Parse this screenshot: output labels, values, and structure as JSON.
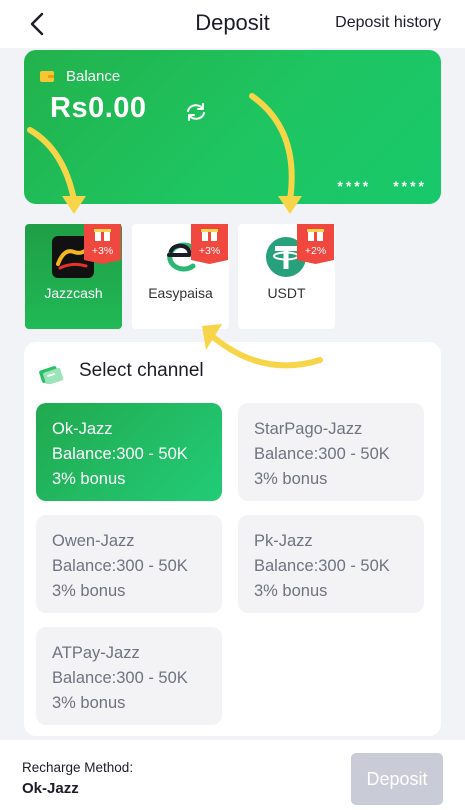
{
  "header": {
    "title": "Deposit",
    "history_label": "Deposit history"
  },
  "balance": {
    "label": "Balance",
    "amount": "Rs0.00",
    "mask_1": "****",
    "mask_2": "****"
  },
  "methods": [
    {
      "label": "Jazzcash",
      "bonus": "+3%",
      "icon": "jazzcash-logo-icon"
    },
    {
      "label": "Easypaisa",
      "bonus": "+3%",
      "icon": "easypaisa-logo-icon"
    },
    {
      "label": "USDT",
      "bonus": "+2%",
      "icon": "tether-logo-icon"
    }
  ],
  "channels": {
    "title": "Select channel",
    "items": [
      {
        "name": "Ok-Jazz",
        "balance": "Balance:300 - 50K",
        "bonus": "3% bonus"
      },
      {
        "name": "StarPago-Jazz",
        "balance": "Balance:300 - 50K",
        "bonus": "3% bonus"
      },
      {
        "name": "Owen-Jazz",
        "balance": "Balance:300 - 50K",
        "bonus": "3% bonus"
      },
      {
        "name": "Pk-Jazz",
        "balance": "Balance:300 - 50K",
        "bonus": "3% bonus"
      },
      {
        "name": "ATPay-Jazz",
        "balance": "Balance:300 - 50K",
        "bonus": "3% bonus"
      }
    ]
  },
  "footer": {
    "method_label": "Recharge Method:",
    "method_value": "Ok-Jazz",
    "deposit_label": "Deposit"
  },
  "colors": {
    "accent_green": "#1ec561",
    "badge_red": "#f0473f",
    "arrow_yellow": "#f7d548",
    "disabled_button": "#c9ccd6"
  }
}
